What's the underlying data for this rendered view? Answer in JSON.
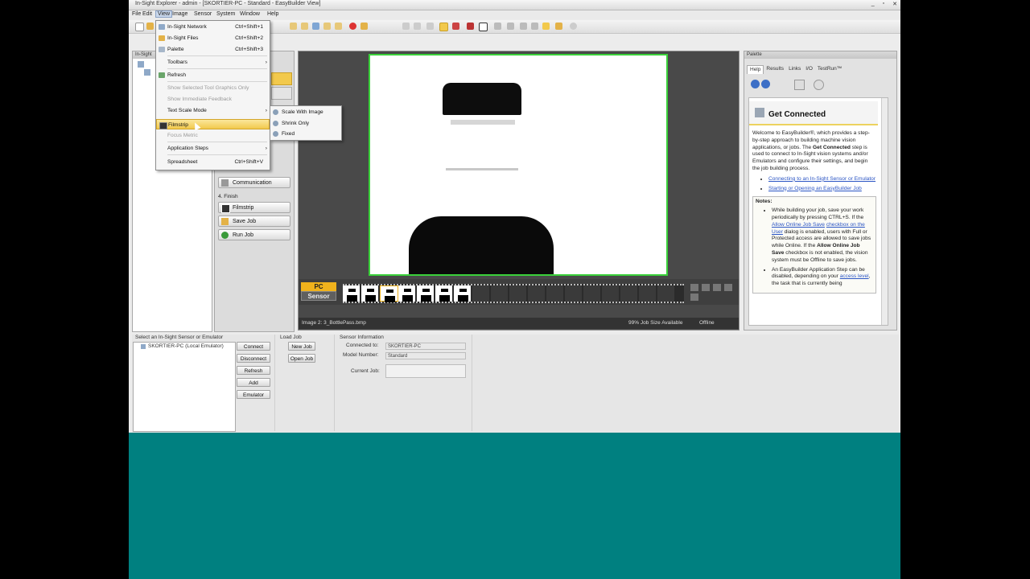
{
  "window": {
    "title": "In-Sight Explorer - admin - [SKORTIER-PC - Standard - EasyBuilder View]",
    "controls": [
      "_",
      "▫",
      "✕"
    ]
  },
  "menubar": [
    "File",
    "Edit",
    "View",
    "Image",
    "Sensor",
    "System",
    "Window",
    "Help"
  ],
  "view_menu": {
    "items": [
      {
        "label": "In-Sight Network",
        "shortcut": "Ctrl+Shift+1"
      },
      {
        "label": "In-Sight Files",
        "shortcut": "Ctrl+Shift+2"
      },
      {
        "label": "Palette",
        "shortcut": "Ctrl+Shift+3"
      },
      {
        "label": "Toolbars",
        "shortcut": ""
      },
      {
        "label": "Refresh",
        "shortcut": ""
      },
      {
        "label": "Show Selected Tool Graphics Only",
        "shortcut": ""
      },
      {
        "label": "Show Immediate Feedback",
        "shortcut": ""
      },
      {
        "label": "Text Scale Mode",
        "shortcut": ""
      },
      {
        "label": "Filmstrip",
        "shortcut": ""
      },
      {
        "label": "Focus Metric",
        "shortcut": ""
      },
      {
        "label": "Application Steps",
        "shortcut": ""
      },
      {
        "label": "Spreadsheet",
        "shortcut": "Ctrl+Shift+V"
      }
    ],
    "submenu": [
      "Scale With Image",
      "Shrink Only",
      "Fixed"
    ]
  },
  "left_panel": {
    "title": "In-Sight"
  },
  "application_steps": {
    "step_partial": "Communication",
    "finish_header": "4. Finish",
    "finish_items": [
      "Filmstrip",
      "Save Job",
      "Run Job"
    ]
  },
  "filmstrip": {
    "pc_label": "PC",
    "sensor_label": "Sensor"
  },
  "status": {
    "image_name": "Image 2: 3_BottlePass.bmp",
    "job_size": "99% Job Size Available",
    "mode": "Offline"
  },
  "palette": {
    "title": "Palette",
    "tabs": [
      "Help",
      "Results",
      "Links",
      "I/O",
      "TestRun™"
    ],
    "help_title": "Get Connected",
    "intro_1": "Welcome to EasyBuilder®, which provides a step-by-step approach to building machine vision applications, or jobs. The ",
    "intro_bold": "Get Connected",
    "intro_2": " step is used to connect to In-Sight vision systems and/or Emulators and configure their settings, and begin the job building process.",
    "links": [
      "Connecting to an In-Sight Sensor or Emulator",
      "Starting or Opening an EasyBuilder Job"
    ],
    "notes_title": "Notes:",
    "note1_a": "While building your job, save your work periodically by pressing CTRL+S. If the ",
    "note1_b": "Allow Online Job Save",
    "note1_c": "checkbox on the User",
    "note1_d": " dialog is enabled, users with Full or Protected access are allowed to save jobs while Online. If the ",
    "note1_e": "Allow Online Job Save",
    "note1_f": " checkbox is not enabled, the vision system must be Offline to save jobs.",
    "note2_a": "An EasyBuilder Application Step can be disabled, depending on your ",
    "note2_b": "access level",
    "note2_c": ", the task that is currently being"
  },
  "bottom": {
    "sensor_header": "Select an In-Sight Sensor or Emulator",
    "sensor_item": "SKORTIER-PC (Local Emulator)",
    "sensor_buttons": [
      "Connect",
      "Disconnect",
      "Refresh",
      "Add",
      "Emulator"
    ],
    "load_header": "Load Job",
    "load_buttons": [
      "New Job",
      "Open Job"
    ],
    "info_header": "Sensor Information",
    "connected_label": "Connected to:",
    "connected_value": "SKORTIER-PC",
    "model_label": "Model Number:",
    "model_value": "Standard",
    "job_label": "Current Job:"
  }
}
